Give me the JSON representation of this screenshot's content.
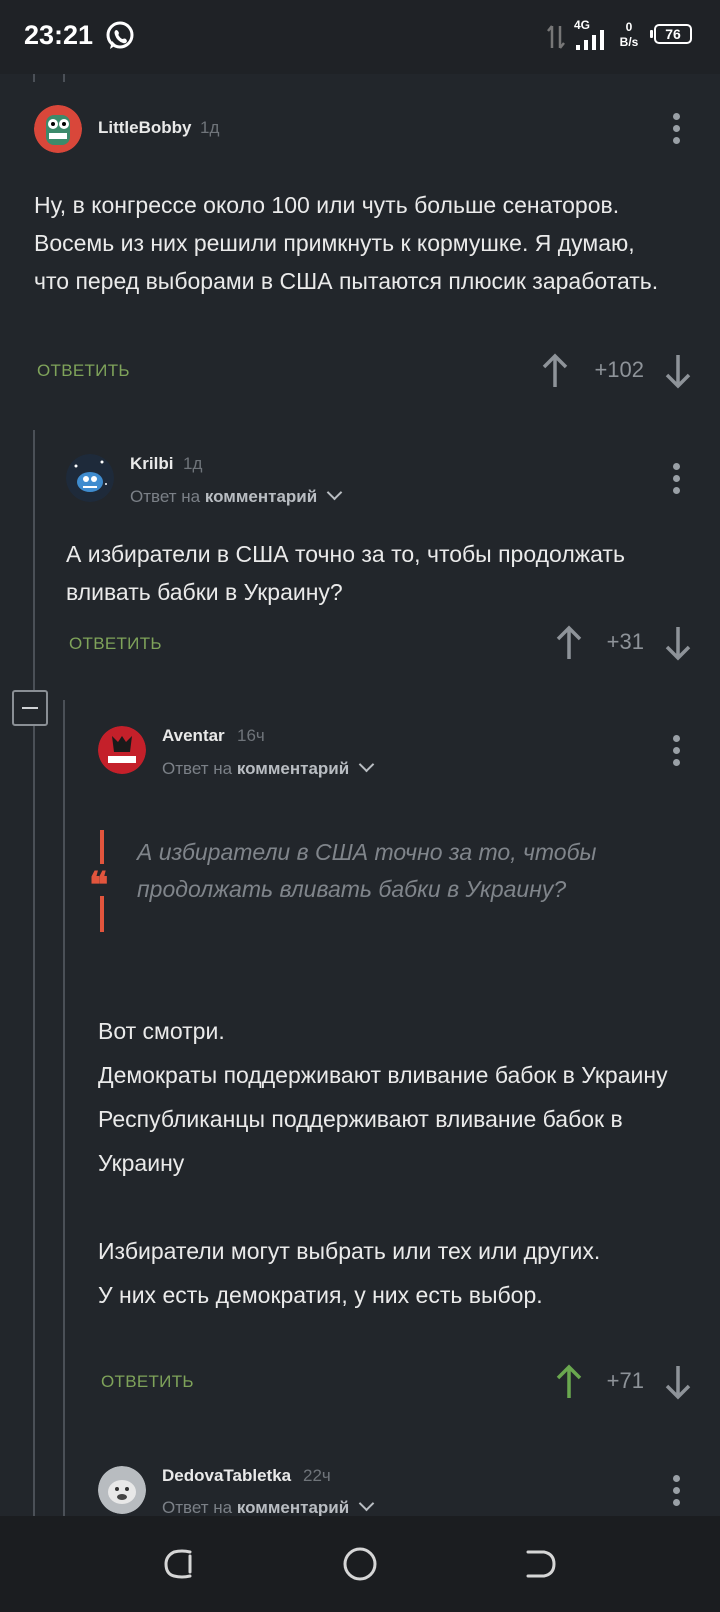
{
  "status_bar": {
    "time": "23:21",
    "network_type": "4G",
    "speed_value": "0",
    "speed_unit": "B/s",
    "battery": "76"
  },
  "comments": [
    {
      "username": "LittleBobby",
      "time_ago": "1д",
      "text": "Ну, в конгрессе около 100 или чуть больше сенаторов. Восемь из них решили примкнуть к кормушке. Я думаю, что перед выборами в США пытаются плюсик заработать.",
      "reply_label": "ОТВЕТИТЬ",
      "score": "+102",
      "upvoted": false
    },
    {
      "username": "Krilbi",
      "time_ago": "1д",
      "reply_to_prefix": "Ответ на",
      "reply_to_target": "комментарий",
      "text": "А избиратели в США точно за то, чтобы продолжать вливать бабки в Украину?",
      "reply_label": "ОТВЕТИТЬ",
      "score": "+31",
      "upvoted": false
    },
    {
      "username": "Aventar",
      "time_ago": "16ч",
      "reply_to_prefix": "Ответ на",
      "reply_to_target": "комментарий",
      "quote": "А избиратели в США точно за то, чтобы продолжать вливать бабки в Украину?",
      "text": "Вот смотри.\nДемократы поддерживают вливание бабок в Украину\nРеспубликанцы поддерживают вливание бабок в Украину\n\nИзбиратели могут выбрать или тех или других.\nУ них есть демократия, у них есть выбор.",
      "reply_label": "ОТВЕТИТЬ",
      "score": "+71",
      "upvoted": true
    },
    {
      "username": "DedovaTabletka",
      "time_ago": "22ч",
      "reply_to_prefix": "Ответ на",
      "reply_to_target": "комментарий"
    }
  ],
  "colors": {
    "background": "#22262b",
    "reply_green": "#7fa35a",
    "upvote_active": "#6aa84f",
    "quote_accent": "#e2553d"
  }
}
